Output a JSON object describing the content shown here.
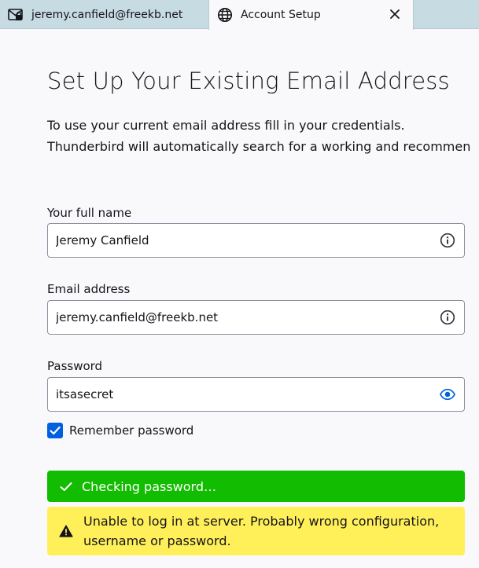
{
  "tabs": [
    {
      "label": "jeremy.canfield@freekb.net",
      "icon": "mail-lock-icon",
      "active": false
    },
    {
      "label": "Account Setup",
      "icon": "globe-icon",
      "active": true
    }
  ],
  "page": {
    "title": "Set Up Your Existing Email Address",
    "description_line1": "To use your current email address fill in your credentials.",
    "description_line2": "Thunderbird will automatically search for a working and recommen"
  },
  "form": {
    "full_name": {
      "label": "Your full name",
      "value": "Jeremy Canfield",
      "icon": "info-icon"
    },
    "email": {
      "label": "Email address",
      "value": "jeremy.canfield@freekb.net",
      "icon": "info-icon"
    },
    "password": {
      "label": "Password",
      "value": "itsasecret",
      "icon": "eye-icon"
    },
    "remember": {
      "label": "Remember password",
      "checked": true
    }
  },
  "status": {
    "success": "Checking password…",
    "warning": "Unable to log in at server. Probably wrong configuration, username or password."
  },
  "colors": {
    "tabbar": "#c7dbe3",
    "success": "#12bc00",
    "warning": "#fff05a",
    "checkbox": "#0061e0",
    "eye_icon": "#0061e0"
  }
}
